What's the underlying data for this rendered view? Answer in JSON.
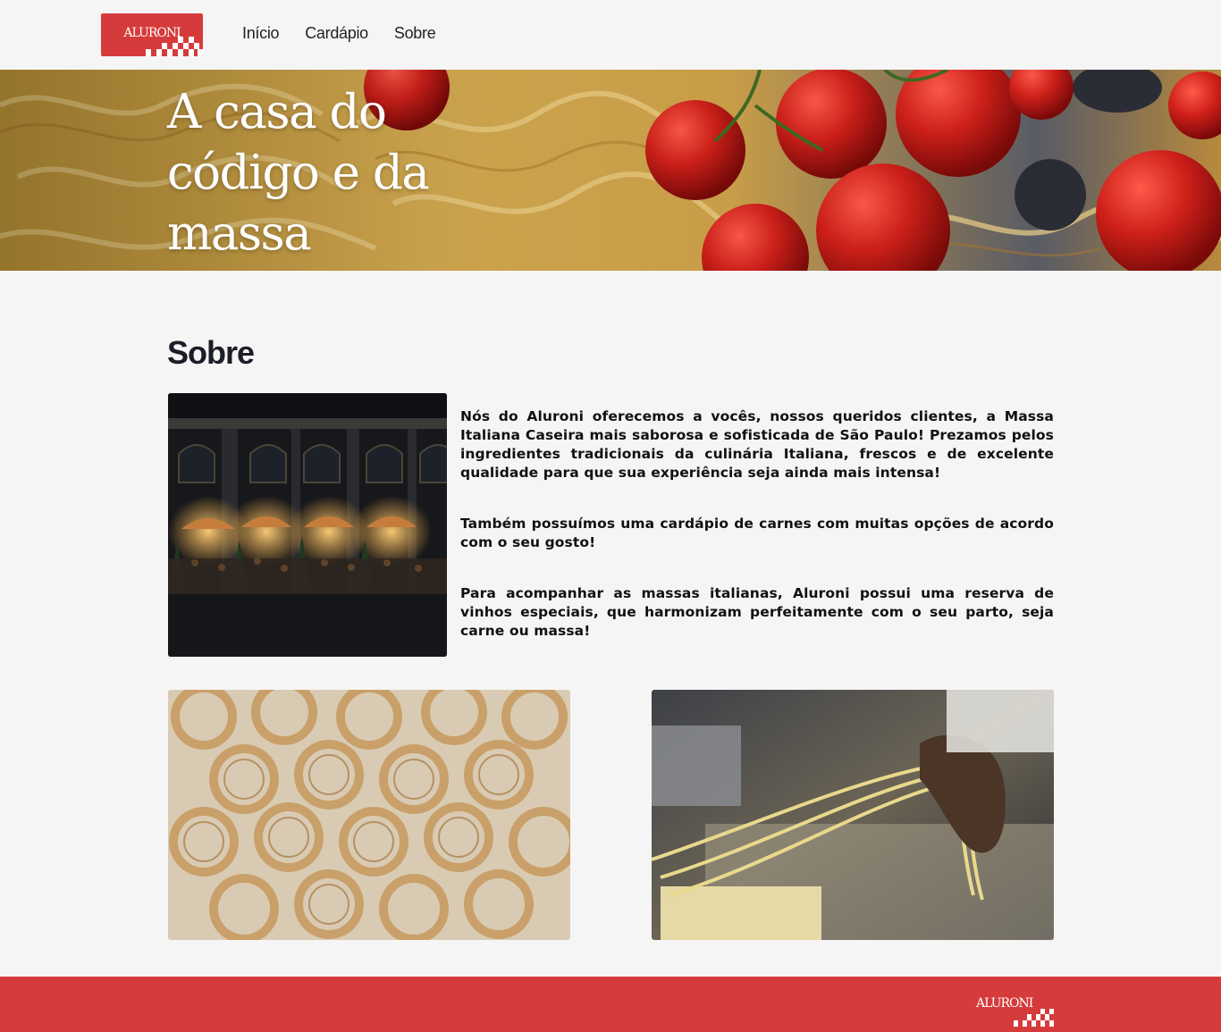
{
  "brand": {
    "logo_text": "ALURONI"
  },
  "nav": {
    "items": [
      {
        "label": "Início"
      },
      {
        "label": "Cardápio"
      },
      {
        "label": "Sobre"
      }
    ]
  },
  "hero": {
    "title": "A casa do código e da massa"
  },
  "about": {
    "title": "Sobre",
    "paragraphs": [
      "Nós do Aluroni oferecemos a vocês, nossos queridos clientes, a Massa Italiana Caseira mais saborosa e sofisticada de São Paulo! Prezamos pelos ingredientes tradicionais da culinária Italiana, frescos e de excelente qualidade para que sua experiência seja ainda mais intensa!",
      "Também possuímos uma cardápio de carnes com muitas opções de acordo com o seu gosto!",
      "Para acompanhar as massas italianas, Aluroni possui uma reserva de vinhos especiais, que harmonizam perfeitamente com o seu parto, seja carne ou massa!"
    ]
  },
  "footer": {
    "logo_text": "ALURONI"
  },
  "colors": {
    "brand_red": "#d63b3b",
    "background": "#f6f5f5",
    "text_dark": "#1b1d27"
  },
  "icons": {
    "logo_pattern": "checkerboard-flag-icon"
  }
}
